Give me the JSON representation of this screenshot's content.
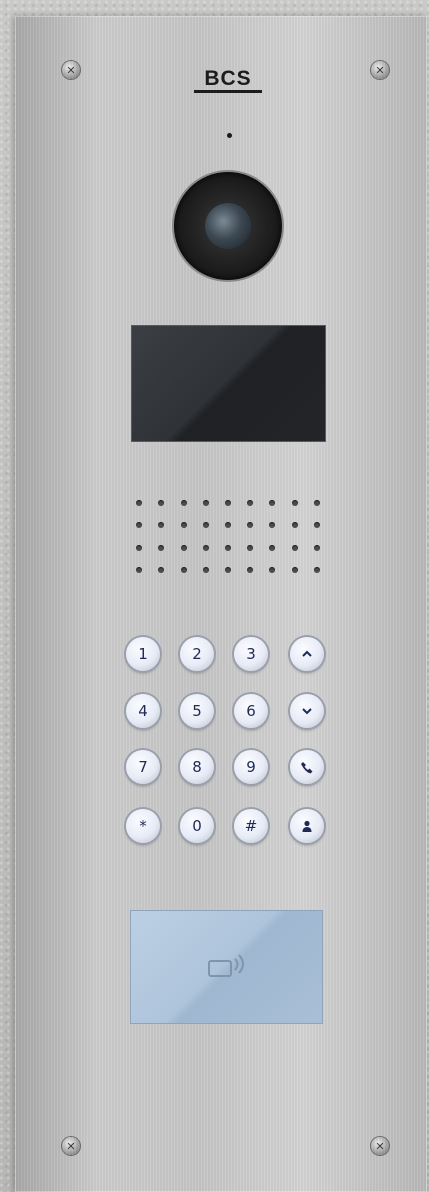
{
  "brand": {
    "logo_text": "BCS"
  },
  "keypad": {
    "keys": [
      {
        "label": "1",
        "name": "key-1"
      },
      {
        "label": "2",
        "name": "key-2"
      },
      {
        "label": "3",
        "name": "key-3"
      },
      {
        "label": "",
        "name": "up-arrow-key",
        "icon": "chevron-up-icon"
      },
      {
        "label": "4",
        "name": "key-4"
      },
      {
        "label": "5",
        "name": "key-5"
      },
      {
        "label": "6",
        "name": "key-6"
      },
      {
        "label": "",
        "name": "down-arrow-key",
        "icon": "chevron-down-icon"
      },
      {
        "label": "7",
        "name": "key-7"
      },
      {
        "label": "8",
        "name": "key-8"
      },
      {
        "label": "9",
        "name": "key-9"
      },
      {
        "label": "",
        "name": "call-key",
        "icon": "phone-icon"
      },
      {
        "label": "*",
        "name": "key-star"
      },
      {
        "label": "0",
        "name": "key-0"
      },
      {
        "label": "#",
        "name": "key-hash"
      },
      {
        "label": "",
        "name": "contact-key",
        "icon": "person-icon"
      }
    ]
  },
  "card_reader": {
    "icon": "nfc-card-icon"
  },
  "colors": {
    "panel": "#c6c6c6",
    "display": "#2f3236",
    "key_face": "#e7ebf6",
    "key_text": "#1f2a55",
    "card_reader": "#aec4da"
  }
}
